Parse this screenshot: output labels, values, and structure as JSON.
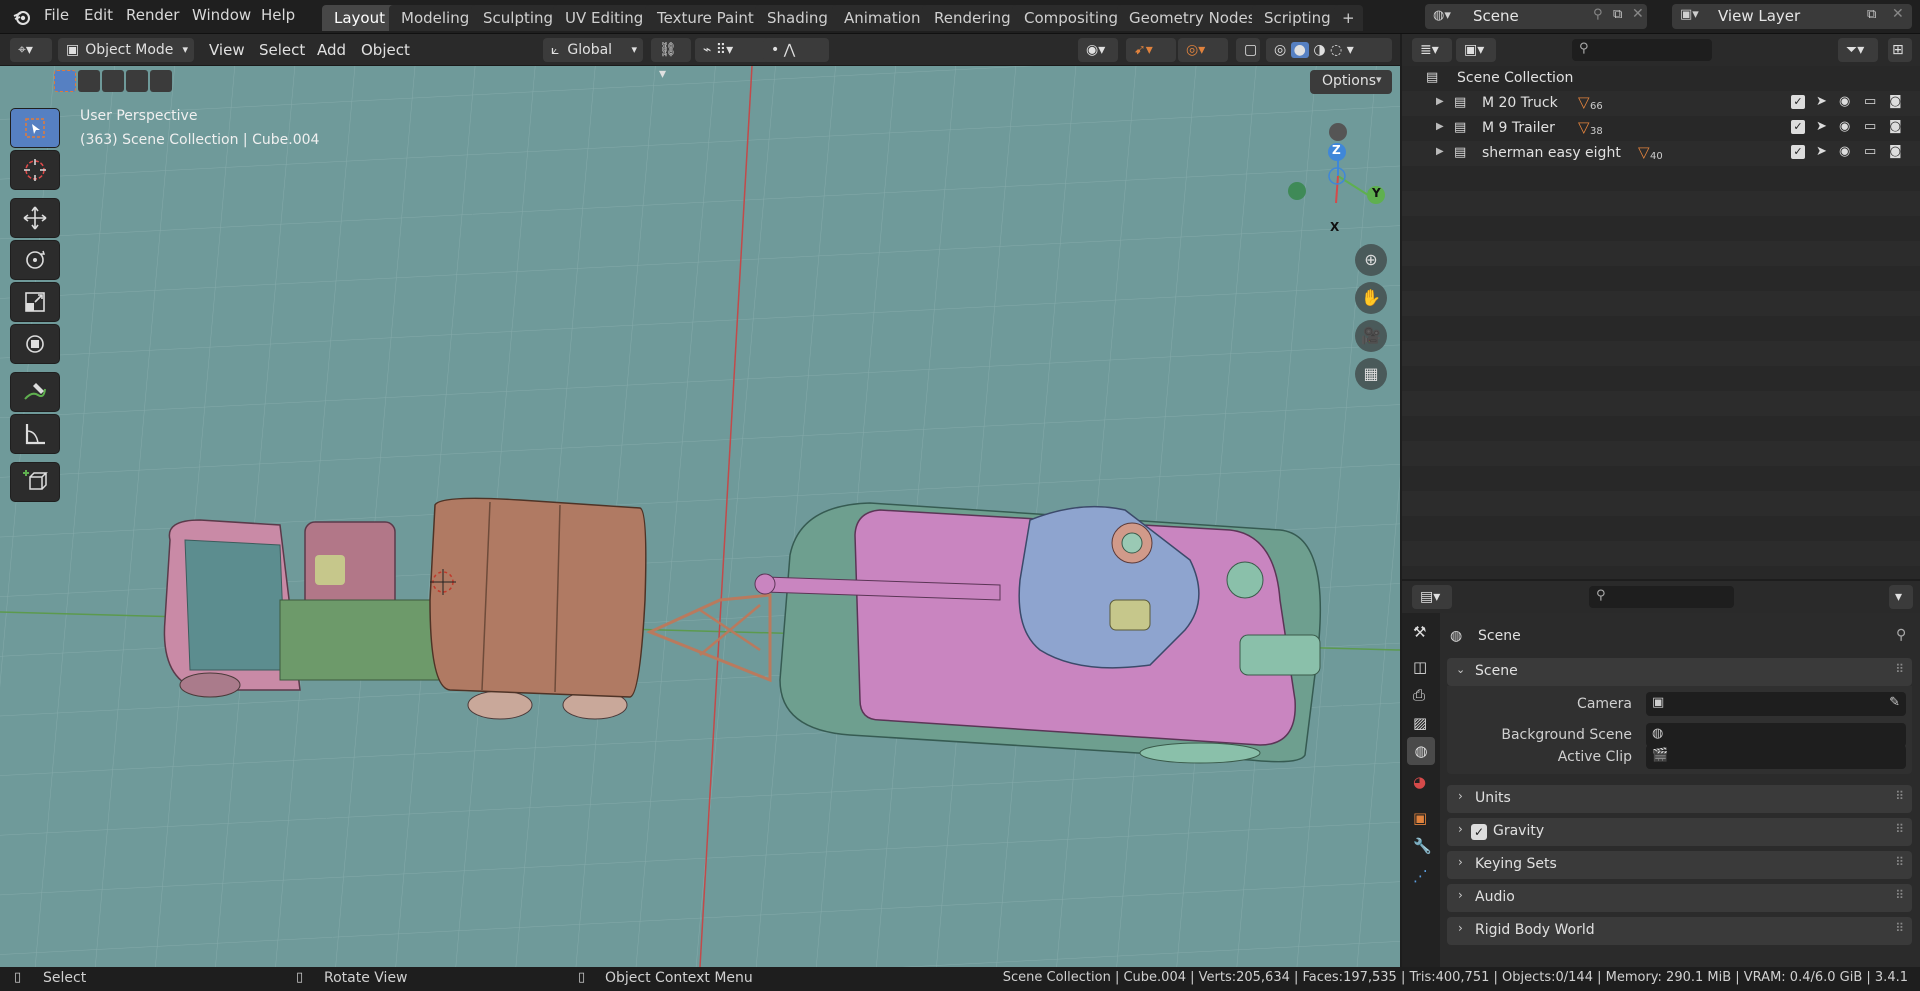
{
  "menu": {
    "items": [
      "File",
      "Edit",
      "Render",
      "Window",
      "Help"
    ]
  },
  "workspaces": {
    "tabs": [
      "Layout",
      "Modeling",
      "Sculpting",
      "UV Editing",
      "Texture Paint",
      "Shading",
      "Animation",
      "Rendering",
      "Compositing",
      "Geometry Nodes",
      "Scripting"
    ],
    "add_label": "+"
  },
  "scene_selector": {
    "value": "Scene"
  },
  "view_layer_selector": {
    "value": "View Layer"
  },
  "viewport_header": {
    "mode": "Object Mode",
    "menus": [
      "View",
      "Select",
      "Add",
      "Object"
    ],
    "orientation": "Global",
    "options_label": "Options"
  },
  "viewport": {
    "perspective_label": "User Perspective",
    "context_label": "(363) Scene Collection | Cube.004",
    "gizmo": {
      "z": "Z",
      "y": "Y",
      "x": "X"
    }
  },
  "outliner": {
    "root": "Scene Collection",
    "collections": [
      {
        "name": "M 20 Truck",
        "count": "66"
      },
      {
        "name": "M 9 Trailer",
        "count": "38"
      },
      {
        "name": "sherman easy eight",
        "count": "40"
      }
    ]
  },
  "properties": {
    "breadcrumb": "Scene",
    "scene_panel": "Scene",
    "rows": {
      "camera": "Camera",
      "background_scene": "Background Scene",
      "active_clip": "Active Clip"
    },
    "collapsed_panels": [
      "Units",
      "Gravity",
      "Keying Sets",
      "Audio",
      "Rigid Body World"
    ],
    "gravity_checked": true
  },
  "statusbar": {
    "select": "Select",
    "rotate": "Rotate View",
    "context_menu": "Object Context Menu",
    "stats": "Scene Collection | Cube.004 | Verts:205,634 | Faces:197,535 | Tris:400,751 | Objects:0/144 | Memory: 290.1 MiB | VRAM: 0.4/6.0 GiB | 3.4.1"
  },
  "colors": {
    "viewport_bg": "#6f9a9a",
    "active_tool": "#5680c2",
    "axis_x": "#d54a4a",
    "axis_y": "#5fb04f",
    "axis_z": "#3f87d9",
    "accent_orange": "#e0823d"
  }
}
